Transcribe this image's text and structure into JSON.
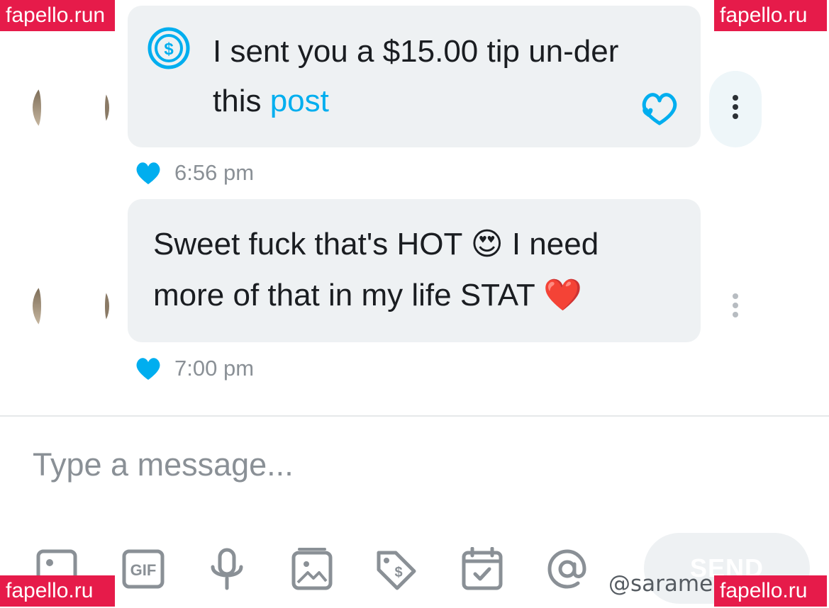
{
  "messages": [
    {
      "type": "tip",
      "text_before": "I sent you a $15.00 tip un-der this ",
      "link_text": "post",
      "time": "6:56 pm"
    },
    {
      "type": "text",
      "text": "Sweet fuck that's HOT 😍 I need more of that in my life STAT ❤️",
      "time": "7:00 pm"
    }
  ],
  "composer": {
    "placeholder": "Type a message...",
    "send_label": "SEND",
    "tools": [
      "image-icon",
      "gif-icon",
      "microphone-icon",
      "media-vault-icon",
      "price-tag-icon",
      "calendar-icon",
      "mention-icon"
    ]
  },
  "overlay": {
    "username": "@sarame",
    "watermark": "fapello.ru",
    "watermark_partial": "fapello.run"
  },
  "colors": {
    "accent": "#00aeef",
    "bubble": "#eef1f3",
    "meta_text": "#8a9096",
    "icon_gray": "#8a9096",
    "watermark_bg": "#e61b4a"
  }
}
